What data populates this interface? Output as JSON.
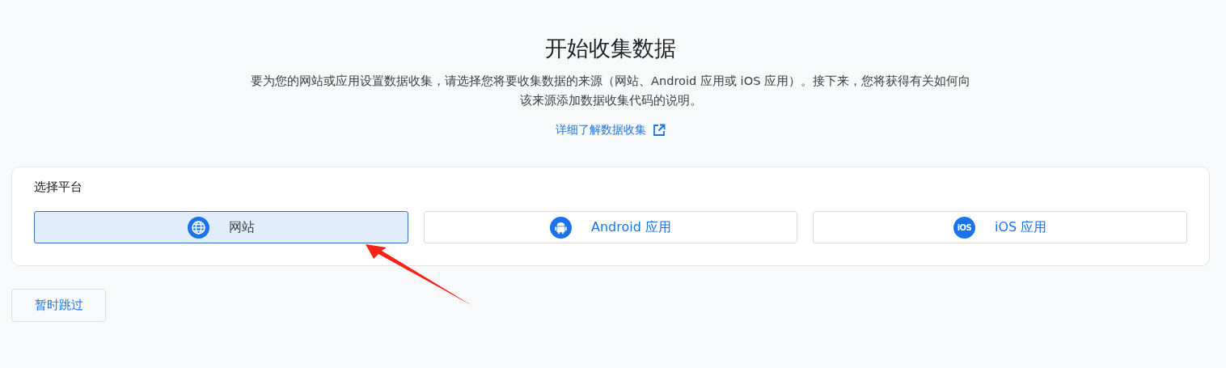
{
  "title": "开始收集数据",
  "description": "要为您的网站或应用设置数据收集，请选择您将要收集数据的来源（网站、Android 应用或 iOS 应用）。接下来，您将获得有关如何向该来源添加数据收集代码的说明。",
  "learn_more_link": "详细了解数据收集",
  "platform_panel": {
    "heading": "选择平台",
    "platforms": [
      {
        "kind": "web",
        "label": "网站",
        "selected": true
      },
      {
        "kind": "android",
        "label": "Android 应用",
        "selected": false
      },
      {
        "kind": "ios",
        "label": "iOS 应用",
        "icon_text": "iOS",
        "selected": false
      }
    ]
  },
  "skip_button": "暂时跳过",
  "annotation": {
    "kind": "arrow"
  }
}
